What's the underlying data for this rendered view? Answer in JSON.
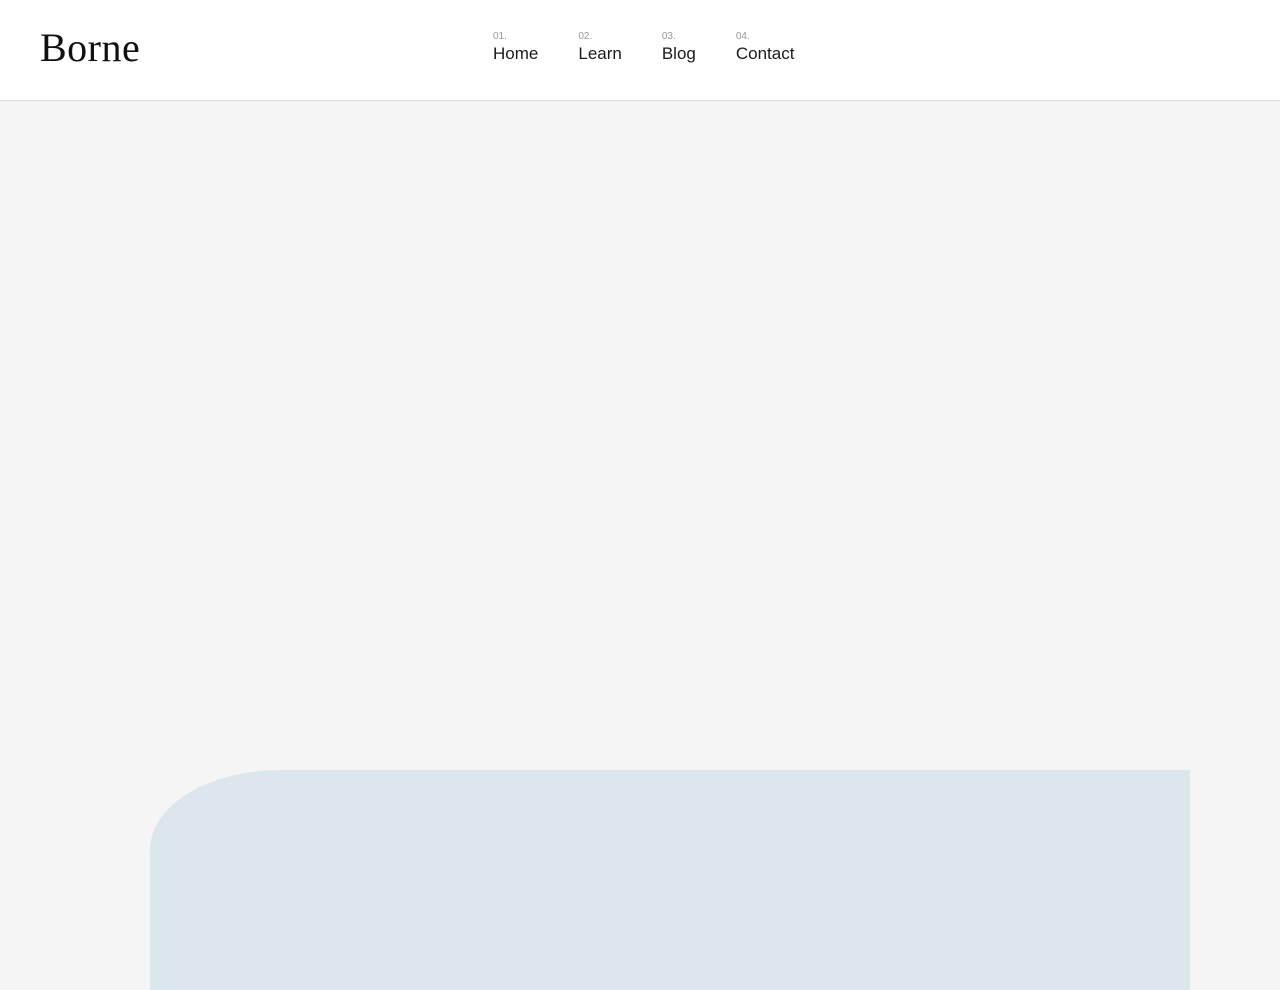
{
  "brand": {
    "logo_text": "Borne"
  },
  "nav": {
    "items": [
      {
        "number": "01.",
        "label": "Home"
      },
      {
        "number": "02.",
        "label": "Learn"
      },
      {
        "number": "03.",
        "label": "Blog"
      },
      {
        "number": "04.",
        "label": "Contact"
      }
    ]
  },
  "colors": {
    "header_background": "#ffffff",
    "page_background": "#f5f5f5",
    "accent_shape": "#dbe7ec",
    "text": "#1a1a1a",
    "muted_text": "#9a9a9a"
  }
}
